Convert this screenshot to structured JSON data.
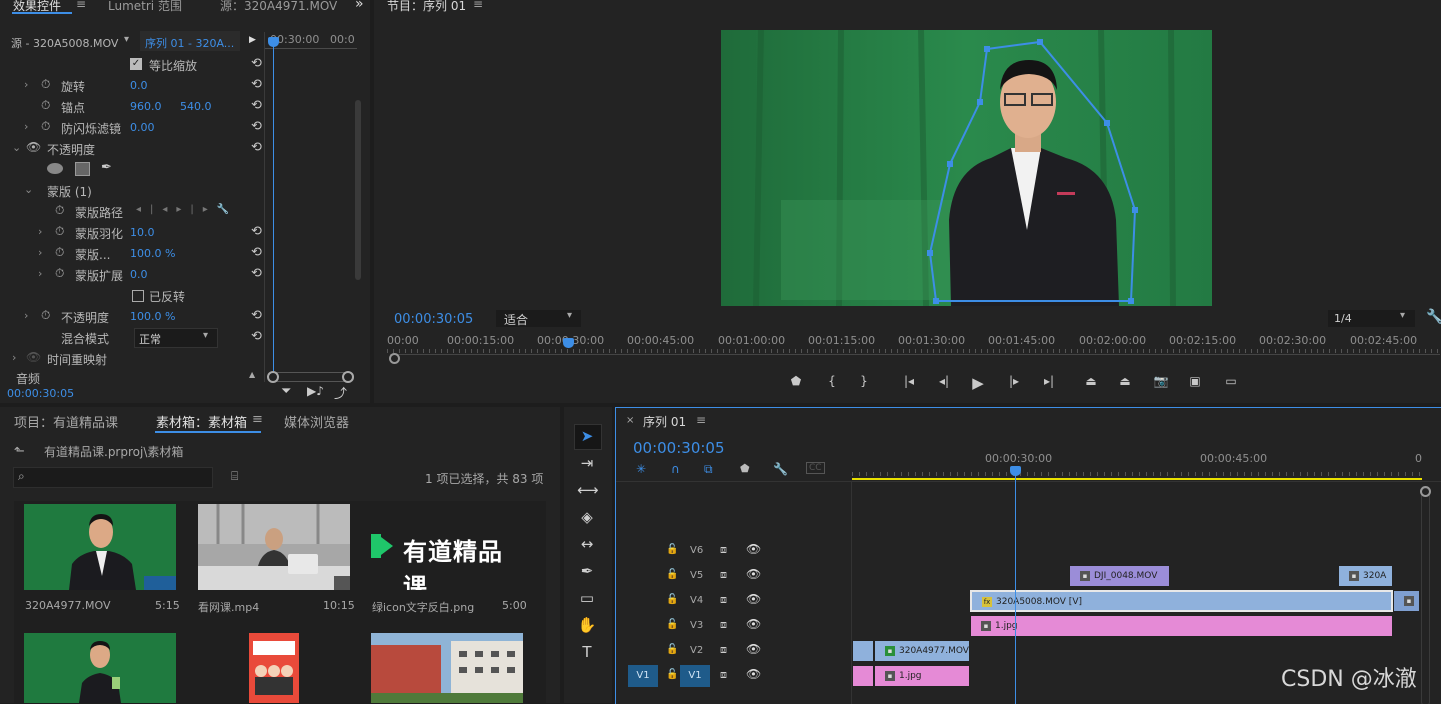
{
  "effects_panel": {
    "tabs": [
      "效果控件",
      "Lumetri 范围",
      "源：320A4971.MOV"
    ],
    "more": "»",
    "source_label": "源 - 320A5008.MOV",
    "sequence_dropdown": "序列 01 - 320A...",
    "ruler_times": [
      "00:30:00",
      "00:0"
    ],
    "uniform_scale_label": "等比缩放",
    "rotation": {
      "label": "旋转",
      "value": "0.0"
    },
    "anchor": {
      "label": "锚点",
      "x": "960.0",
      "y": "540.0"
    },
    "anti_flicker": {
      "label": "防闪烁滤镜",
      "value": "0.00"
    },
    "opacity_section": "不透明度",
    "mask_group": "蒙版 (1)",
    "mask_path": "蒙版路径",
    "mask_feather": {
      "label": "蒙版羽化",
      "value": "10.0"
    },
    "mask_opacity": {
      "label": "蒙版...",
      "value": "100.0 %"
    },
    "mask_expansion": {
      "label": "蒙版扩展",
      "value": "0.0"
    },
    "inverted_label": "已反转",
    "opacity": {
      "label": "不透明度",
      "value": "100.0 %"
    },
    "blend_mode": {
      "label": "混合模式",
      "value": "正常"
    },
    "time_remap": "时间重映射",
    "audio": "音频",
    "timecode": "00:00:30:05"
  },
  "program_monitor": {
    "tab": "节目：序列 01",
    "timecode": "00:00:30:05",
    "fit": "适合",
    "resolution": "1/4",
    "ruler": [
      "00:00",
      "00:00:15:00",
      "00:00:30:00",
      "00:00:45:00",
      "00:01:00:00",
      "00:01:15:00",
      "00:01:30:00",
      "00:01:45:00",
      "00:02:00:00",
      "00:02:15:00",
      "00:02:30:00",
      "00:02:45:00"
    ]
  },
  "project_panel": {
    "tabs": [
      "项目：有道精品课",
      "素材箱：素材箱",
      "媒体浏览器"
    ],
    "path": "有道精品课.prproj\\素材箱",
    "selection_info": "1 项已选择，共 83 项",
    "items": [
      {
        "name": "320A4977.MOV",
        "duration": "5:15"
      },
      {
        "name": "看网课.mp4",
        "duration": "10:15"
      },
      {
        "name": "绿icon文字反白.png",
        "duration": "5:00"
      }
    ],
    "logo_text": "有道精品课"
  },
  "timeline": {
    "tab": "序列 01",
    "timecode": "00:00:30:05",
    "ruler": [
      "00:00:30:00",
      "00:00:45:00",
      "0"
    ],
    "tracks": [
      "V6",
      "V5",
      "V4",
      "V3",
      "V2",
      "V1"
    ],
    "src_patch": "V1",
    "clips": {
      "v5a": "DJI_0048.MOV",
      "v5b": "320A",
      "v4": "320A5008.MOV [V]",
      "v3": "1.jpg",
      "v2": "320A4977.MOV",
      "v1": "1.jpg"
    }
  },
  "watermark": "CSDN @冰澈"
}
